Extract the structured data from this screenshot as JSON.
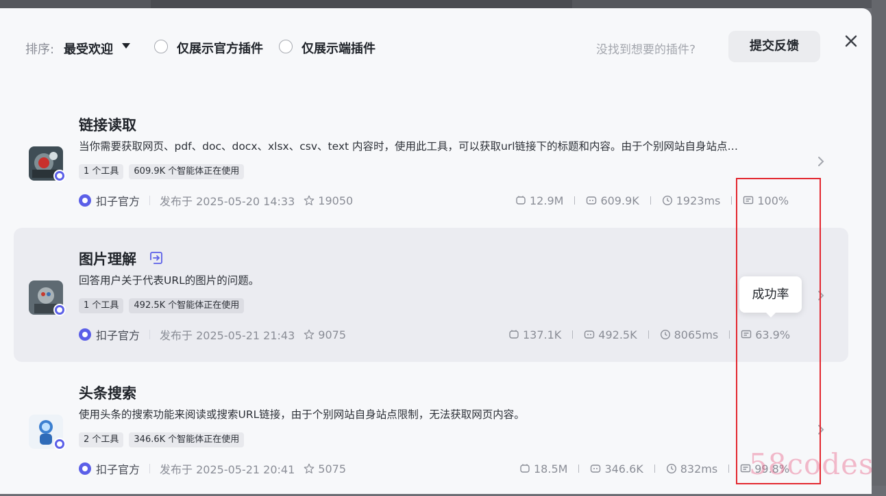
{
  "toolbar": {
    "sort_label": "排序:",
    "sort_value": "最受欢迎",
    "filter_official": "仅展示官方插件",
    "filter_device": "仅展示端插件",
    "hint": "没找到想要的插件?",
    "feedback_button": "提交反馈"
  },
  "plugins": [
    {
      "title": "链接读取",
      "description": "当你需要获取网页、pdf、doc、docx、xlsx、csv、text 内容时，使用此工具，可以获取url链接下的标题和内容。由于个别网站自身站点…",
      "tags": [
        "1 个工具",
        "609.9K 个智能体正在使用"
      ],
      "publisher": "扣子官方",
      "published": "发布于 2025-05-20 14:33",
      "stars": "19050",
      "calls": "12.9M",
      "bots": "609.9K",
      "latency": "1923ms",
      "success": "100%"
    },
    {
      "title": "图片理解",
      "description": "回答用户关于代表URL的图片的问题。",
      "tags": [
        "1 个工具",
        "492.5K 个智能体正在使用"
      ],
      "publisher": "扣子官方",
      "published": "发布于 2025-05-21 21:43",
      "stars": "9075",
      "calls": "137.1K",
      "bots": "492.5K",
      "latency": "8065ms",
      "success": "63.9%"
    },
    {
      "title": "头条搜索",
      "description": "使用头条的搜索功能来阅读或搜索URL链接，由于个别网站自身站点限制，无法获取网页内容。",
      "tags": [
        "2 个工具",
        "346.6K 个智能体正在使用"
      ],
      "publisher": "扣子官方",
      "published": "发布于 2025-05-21 20:41",
      "stars": "5075",
      "calls": "18.5M",
      "bots": "346.6K",
      "latency": "832ms",
      "success": "99.8%"
    }
  ],
  "tooltip": "成功率",
  "watermark": "58codes",
  "colors": {
    "accent": "#5b5fe8",
    "highlight": "#e3262e"
  }
}
